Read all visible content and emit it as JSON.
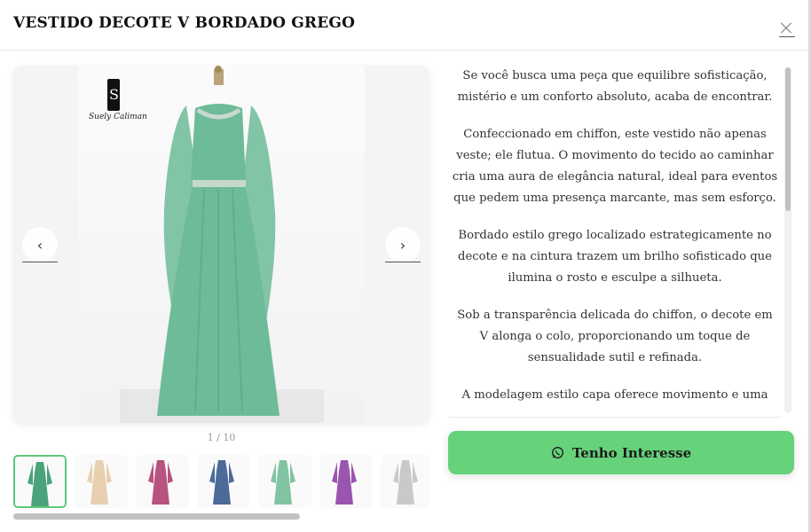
{
  "modal": {
    "title": "VESTIDO DECOTE V BORDADO GREGO"
  },
  "gallery": {
    "brand_text": "Suely Caliman",
    "prev_icon": "‹",
    "next_icon": "›",
    "counter": "1 / 10",
    "dress_color": "#6dbb98",
    "thumbnails": [
      {
        "color": "#4aa37a",
        "active": true
      },
      {
        "color": "#e8cfb0",
        "active": false
      },
      {
        "color": "#b8527e",
        "active": false
      },
      {
        "color": "#4d6b99",
        "active": false
      },
      {
        "color": "#80c4a2",
        "active": false
      },
      {
        "color": "#9a55b0",
        "active": false
      },
      {
        "color": "#c9c9cc",
        "active": false
      }
    ]
  },
  "description": {
    "paragraphs": [
      "Se você busca uma peça que equilibre sofisticação, mistério e um conforto absoluto, acaba de encontrar.",
      "Confeccionado em chiffon, este vestido não apenas veste; ele flutua. O movimento do tecido ao caminhar cria uma aura de elegância natural, ideal para eventos que pedem uma presença marcante, mas sem esforço.",
      "Bordado estilo grego localizado estrategicamente no decote e na cintura trazem um brilho sofisticado que ilumina o rosto e esculpe a silhueta.",
      "Sob a transparência delicada do chiffon, o decote em V alonga o colo, proporcionando um toque de sensualidade sutil e refinada.",
      "A modelagem estilo capa oferece movimento e uma"
    ]
  },
  "cta": {
    "label": "Tenho Interesse",
    "icon": "whatsapp-icon",
    "color": "#66d27a"
  },
  "colors": {
    "accent_green": "#5ec97a",
    "accent_red": "#e0493b"
  }
}
